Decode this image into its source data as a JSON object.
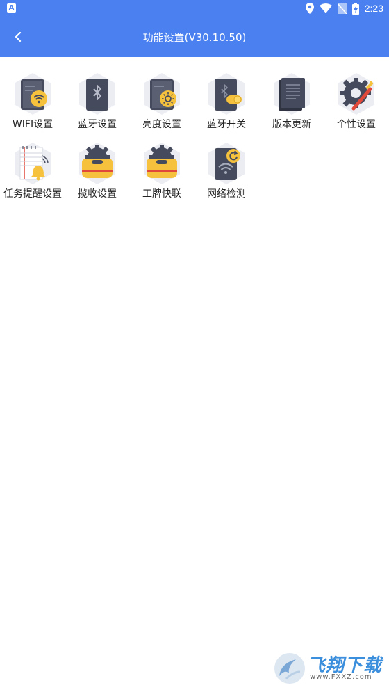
{
  "status_bar": {
    "time": "2:23",
    "app_badge": "A"
  },
  "header": {
    "title": "功能设置(V30.10.50)"
  },
  "tiles": [
    {
      "label": "WIFI设置",
      "icon": "wifi-settings-icon"
    },
    {
      "label": "蓝牙设置",
      "icon": "bluetooth-settings-icon"
    },
    {
      "label": "亮度设置",
      "icon": "brightness-settings-icon"
    },
    {
      "label": "蓝牙开关",
      "icon": "bluetooth-toggle-icon"
    },
    {
      "label": "版本更新",
      "icon": "version-update-icon"
    },
    {
      "label": "个性设置",
      "icon": "personalization-icon"
    },
    {
      "label": "任务提醒设置",
      "icon": "task-reminder-icon"
    },
    {
      "label": "揽收设置",
      "icon": "pickup-settings-icon"
    },
    {
      "label": "工牌快联",
      "icon": "badge-quick-link-icon"
    },
    {
      "label": "网络检测",
      "icon": "network-check-icon"
    }
  ],
  "watermark": {
    "brand": "飞翔下载",
    "url": "www.FXXZ.com"
  },
  "colors": {
    "primary": "#4a80f0",
    "icon_dark": "#454a5c",
    "icon_accent": "#f6c23e",
    "hex_bg": "#ecedf3"
  }
}
